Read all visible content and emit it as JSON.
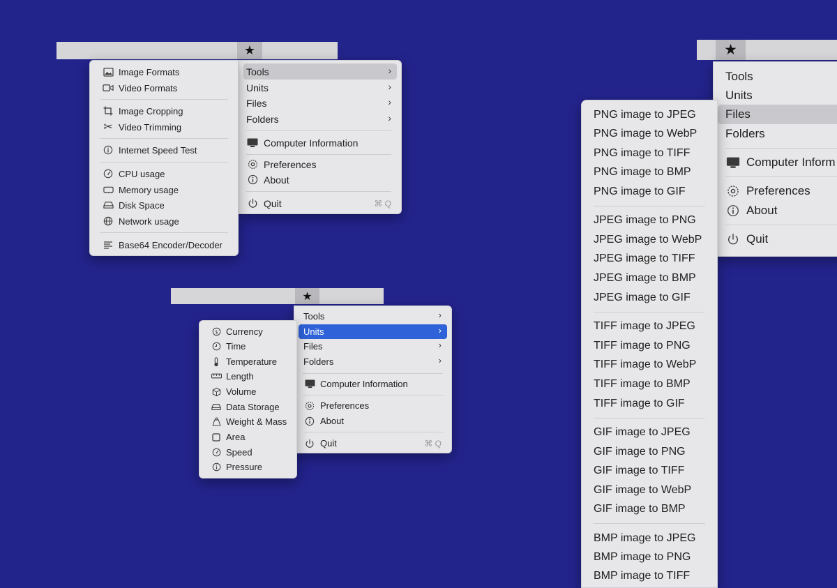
{
  "colors": {
    "desktop": "#23238c",
    "menu_bg": "#e7e6e8",
    "highlight": "#c9c8cc",
    "selection": "#2f62d8"
  },
  "main_menu": {
    "tools": "Tools",
    "units": "Units",
    "files": "Files",
    "folders": "Folders",
    "computer_info": "Computer Information",
    "preferences": "Preferences",
    "about": "About",
    "quit": "Quit",
    "quit_shortcut": "⌘ Q"
  },
  "large_menu": {
    "computer_info": "Computer Inform"
  },
  "tools_menu": {
    "image_formats": "Image Formats",
    "video_formats": "Video Formats",
    "image_cropping": "Image Cropping",
    "video_trimming": "Video Trimming",
    "speed_test": "Internet Speed Test",
    "cpu": "CPU usage",
    "memory": "Memory usage",
    "disk": "Disk Space",
    "network": "Network usage",
    "base64": "Base64 Encoder/Decoder"
  },
  "units_menu": {
    "currency": "Currency",
    "time": "Time",
    "temperature": "Temperature",
    "length": "Length",
    "volume": "Volume",
    "data_storage": "Data Storage",
    "weight": "Weight & Mass",
    "area": "Area",
    "speed": "Speed",
    "pressure": "Pressure"
  },
  "files_menu": {
    "png_jpeg": "PNG image to JPEG",
    "png_webp": "PNG image to WebP",
    "png_tiff": "PNG image to TIFF",
    "png_bmp": "PNG image to BMP",
    "png_gif": "PNG image to GIF",
    "jpeg_png": "JPEG image to PNG",
    "jpeg_webp": "JPEG image to WebP",
    "jpeg_tiff": "JPEG image to TIFF",
    "jpeg_bmp": "JPEG image to BMP",
    "jpeg_gif": "JPEG image to GIF",
    "tiff_jpeg": "TIFF image to JPEG",
    "tiff_png": "TIFF image to PNG",
    "tiff_webp": "TIFF image to WebP",
    "tiff_bmp": "TIFF image to BMP",
    "tiff_gif": "TIFF image to GIF",
    "gif_jpeg": "GIF image to JPEG",
    "gif_png": "GIF image to PNG",
    "gif_tiff": "GIF image to TIFF",
    "gif_webp": "GIF image to WebP",
    "gif_bmp": "GIF image to BMP",
    "bmp_jpeg": "BMP image to JPEG",
    "bmp_png": "BMP image to PNG",
    "bmp_tiff": "BMP image to TIFF"
  }
}
